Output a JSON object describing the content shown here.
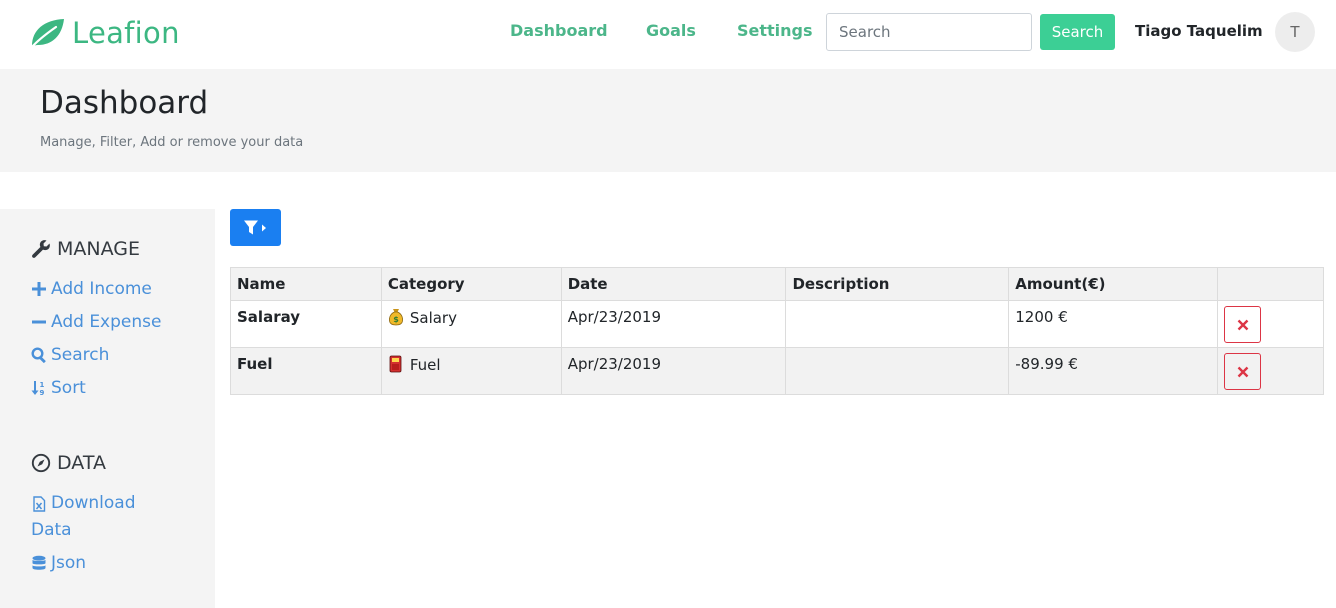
{
  "brand": {
    "name": "Leafion",
    "color": "#3cb782"
  },
  "nav": {
    "links": [
      "Dashboard",
      "Goals",
      "Settings"
    ],
    "search_placeholder": "Search",
    "search_button": "Search",
    "user_name": "Tiago Taquelim",
    "avatar_initial": "T"
  },
  "header": {
    "title": "Dashboard",
    "subtitle": "Manage, Filter, Add or remove your data"
  },
  "sidebar": {
    "manage_heading": "MANAGE",
    "manage_items": [
      {
        "label": "Add Income",
        "icon": "plus-icon"
      },
      {
        "label": "Add Expense",
        "icon": "minus-icon"
      },
      {
        "label": "Search",
        "icon": "search-icon"
      },
      {
        "label": "Sort",
        "icon": "sort-icon"
      }
    ],
    "data_heading": "DATA",
    "data_items": [
      {
        "label_line1": "Download",
        "label_line2": "Data",
        "icon": "excel-file-icon"
      },
      {
        "label": "Json",
        "icon": "database-icon"
      }
    ]
  },
  "table": {
    "headers": [
      "Name",
      "Category",
      "Date",
      "Description",
      "Amount(€)",
      ""
    ],
    "rows": [
      {
        "name": "Salaray",
        "category": "Salary",
        "category_icon": "money-bag-icon",
        "date": "Apr/23/2019",
        "description": "",
        "amount": "1200 €",
        "amount_sign": "positive"
      },
      {
        "name": "Fuel",
        "category": "Fuel",
        "category_icon": "fuel-pump-icon",
        "date": "Apr/23/2019",
        "description": "",
        "amount": "-89.99 €",
        "amount_sign": "negative"
      }
    ]
  },
  "colors": {
    "accent_green": "#3ccf95",
    "link_blue": "#4a90d9",
    "filter_blue": "#1a7ff1",
    "danger_red": "#dc3545",
    "positive_green": "#2e8b2e"
  }
}
